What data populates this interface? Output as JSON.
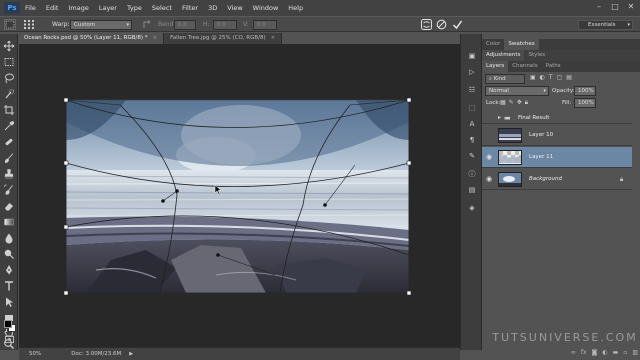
{
  "app": {
    "logo": "Ps"
  },
  "menu": [
    "File",
    "Edit",
    "Image",
    "Layer",
    "Type",
    "Select",
    "Filter",
    "3D",
    "View",
    "Window",
    "Help"
  ],
  "window_controls": [
    "–",
    "□",
    "✕"
  ],
  "options": {
    "warp_label": "Warp:",
    "warp_value": "Custom",
    "bend_label": "Bend:",
    "bend_value": "0.0",
    "h_label": "H:",
    "h_value": "0.0",
    "v_label": "V:",
    "v_value": "0.0",
    "workspace": "Essentials"
  },
  "tabs": [
    {
      "label": "Ocean Rocks.psd @ 50% (Layer 11, RGB/8) *",
      "close": "×",
      "active": true
    },
    {
      "label": "Fallen Tree.jpg @ 25% (CO, RGB/8)",
      "close": "×",
      "active": false
    }
  ],
  "status": {
    "zoom": "50%",
    "doc": "Doc: 3.00M/23.6M"
  },
  "panels": {
    "top_tabs": [
      "Color",
      "Swatches"
    ],
    "mid_tabs": [
      "Adjustments",
      "Styles"
    ],
    "layer_tabs": [
      "Layers",
      "Channels",
      "Paths"
    ],
    "kind_label": "Kind",
    "blend_mode": "Normal",
    "opacity_label": "Opacity:",
    "opacity_value": "100%",
    "lock_label": "Lock:",
    "fill_label": "Fill:",
    "fill_value": "100%",
    "layers": [
      {
        "name": "Final Result",
        "type": "group",
        "selected": false,
        "visible": false
      },
      {
        "name": "Layer 10",
        "type": "layer",
        "selected": false,
        "visible": false
      },
      {
        "name": "Layer 11",
        "type": "layer",
        "selected": true,
        "visible": true
      },
      {
        "name": "Background",
        "type": "background",
        "selected": false,
        "visible": true
      }
    ]
  },
  "watermark": "TUTSUNIVERSE.COM"
}
